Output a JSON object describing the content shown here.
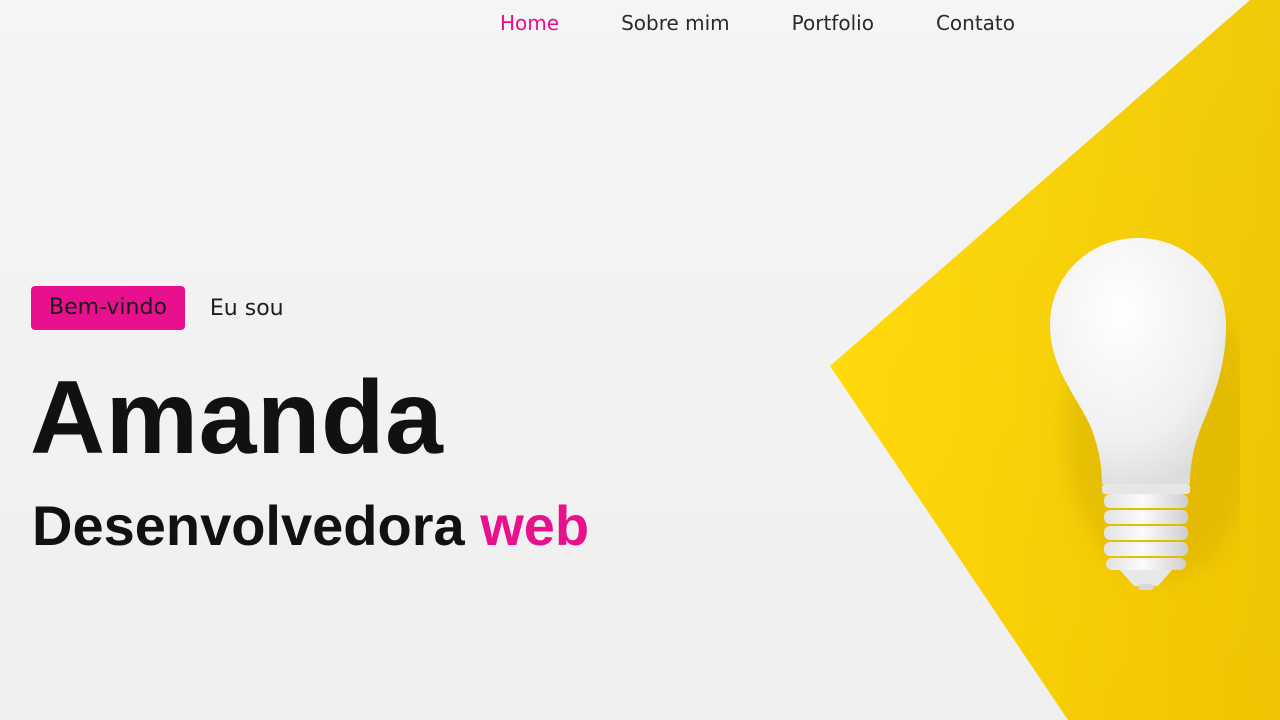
{
  "nav": {
    "items": [
      {
        "label": "Home",
        "active": true
      },
      {
        "label": "Sobre mim",
        "active": false
      },
      {
        "label": "Portfolio",
        "active": false
      },
      {
        "label": "Contato",
        "active": false
      }
    ]
  },
  "hero": {
    "badge": "Bem-vindo",
    "intro": "Eu sou",
    "name": "Amanda",
    "role_prefix": "Desenvolvedora",
    "role_accent": "web"
  },
  "colors": {
    "accent": "#e8108d",
    "yellow": "#ffd400",
    "background": "#f2f2f2",
    "text": "#111111"
  },
  "icons": {
    "hero_image": "lightbulb-icon"
  }
}
